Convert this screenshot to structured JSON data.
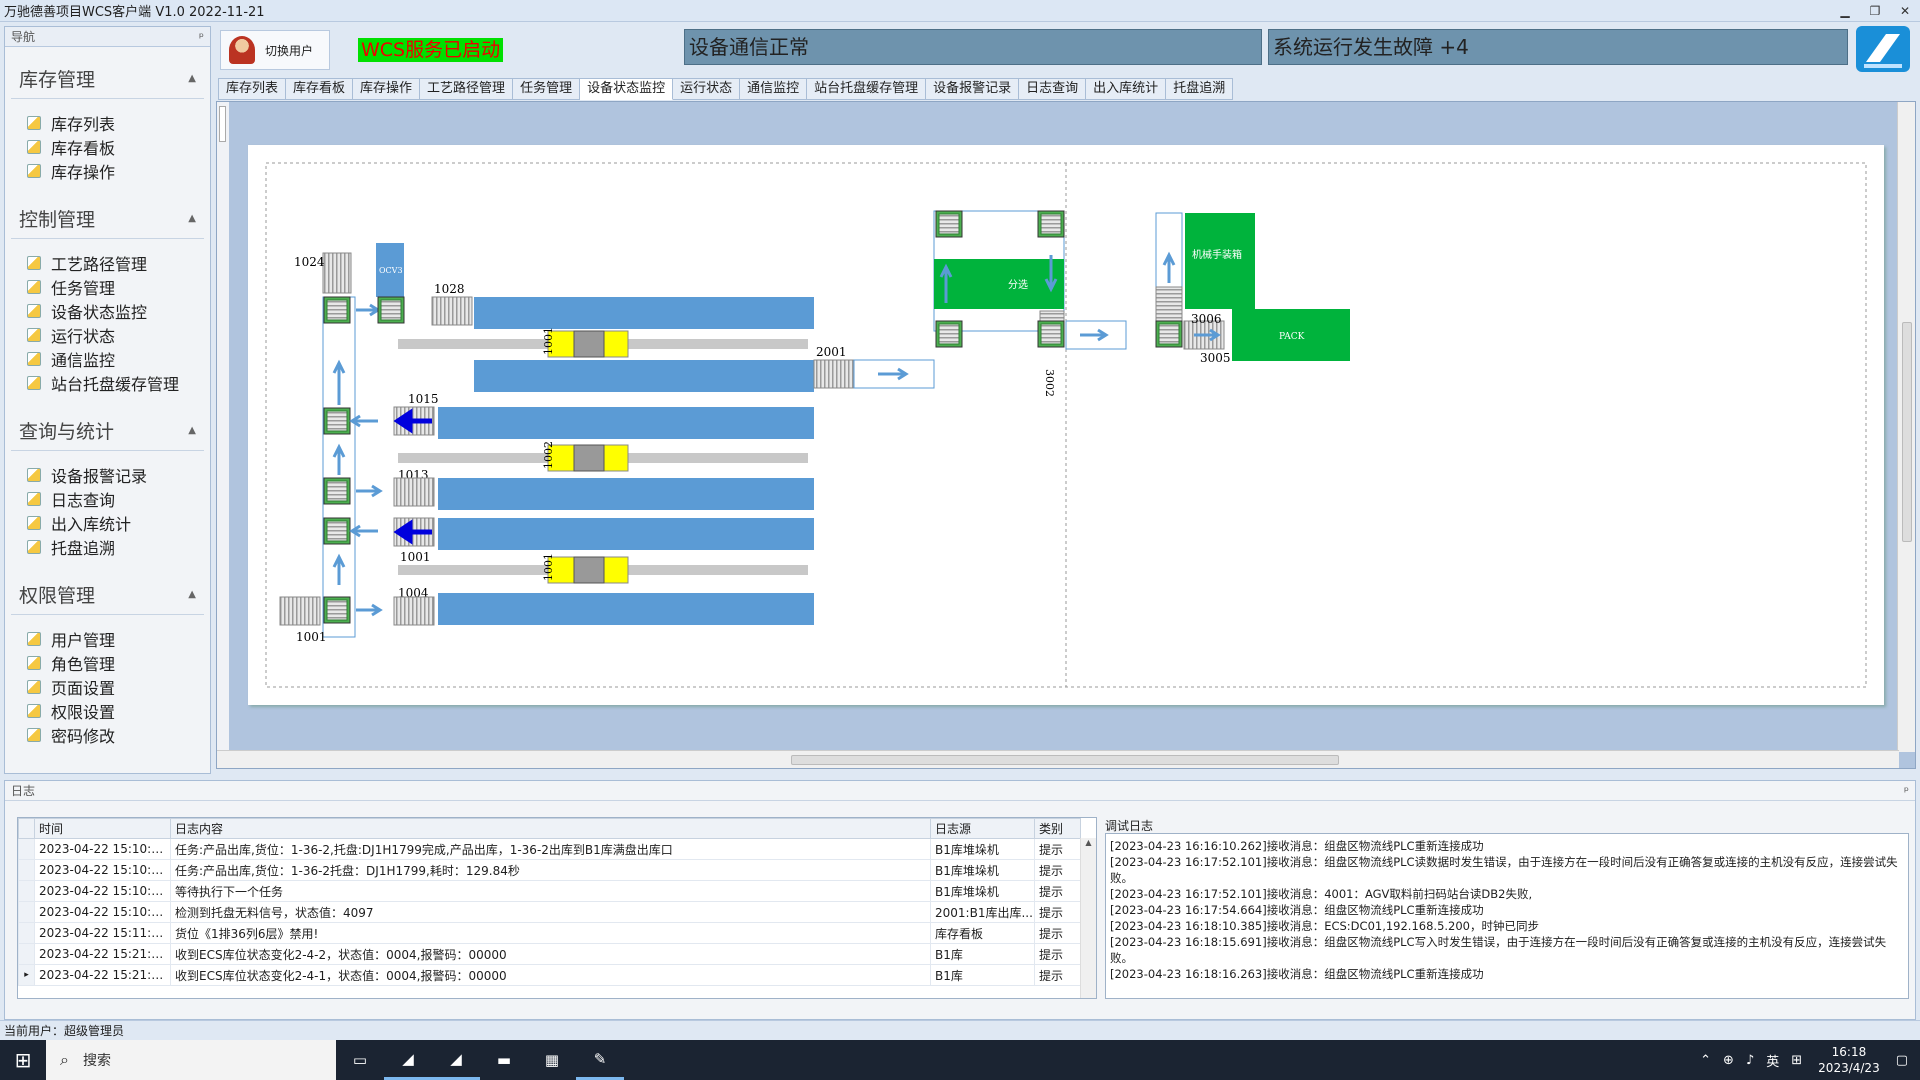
{
  "window": {
    "title": "万驰德善项目WCS客户端 V1.0 2022-11-21",
    "min": "▁",
    "max": "❐",
    "close": "✕"
  },
  "nav": {
    "title": "导航",
    "pin": "ᵖ",
    "groups": [
      {
        "title": "库存管理",
        "items": [
          "库存列表",
          "库存看板",
          "库存操作"
        ]
      },
      {
        "title": "控制管理",
        "items": [
          "工艺路径管理",
          "任务管理",
          "设备状态监控",
          "运行状态",
          "通信监控",
          "站台托盘缓存管理"
        ]
      },
      {
        "title": "查询与统计",
        "items": [
          "设备报警记录",
          "日志查询",
          "出入库统计",
          "托盘追溯"
        ]
      },
      {
        "title": "权限管理",
        "items": [
          "用户管理",
          "角色管理",
          "页面设置",
          "权限设置",
          "密码修改"
        ]
      }
    ]
  },
  "top": {
    "switch_user": "切换用户",
    "service_status": "WCS服务已启动",
    "device_status": "设备通信正常",
    "fault_status": "系统运行发生故障 +4"
  },
  "tabs": [
    "库存列表",
    "库存看板",
    "库存操作",
    "工艺路径管理",
    "任务管理",
    "设备状态监控",
    "运行状态",
    "通信监控",
    "站台托盘缓存管理",
    "设备报警记录",
    "日志查询",
    "出入库统计",
    "托盘追溯"
  ],
  "active_tab": "设备状态监控",
  "diagram": {
    "labels": {
      "n1024": "1024",
      "ocv3": "OCV3",
      "n1028": "1028",
      "n2001": "2001",
      "n1015": "1015",
      "n1013": "1013",
      "n1001a": "1001",
      "n1004": "1004",
      "n1001b": "1001",
      "sort": "分选",
      "n3002": "3002",
      "robot": "机械手装箱",
      "n3006": "3006",
      "pack": "PACK",
      "n3005": "3005",
      "s1": "1001",
      "s2": "1002",
      "s3": "1001"
    }
  },
  "log": {
    "title": "日志",
    "pin": "ᵖ",
    "columns": [
      "时间",
      "日志内容",
      "日志源",
      "类别"
    ],
    "rows": [
      [
        "2023-04-22 15:10:3...",
        "任务:产品出库,货位：1-36-2,托盘:DJ1H1799完成,产品出库，1-36-2出库到B1库满盘出库口",
        "B1库堆垛机",
        "提示"
      ],
      [
        "2023-04-22 15:10:3...",
        "任务:产品出库,货位：1-36-2托盘：DJ1H1799,耗时：129.84秒",
        "B1库堆垛机",
        "提示"
      ],
      [
        "2023-04-22 15:10:3...",
        "等待执行下一个任务",
        "B1库堆垛机",
        "提示"
      ],
      [
        "2023-04-22 15:10:4...",
        "检测到托盘无料信号，状态值：4097",
        "2001:B1库出库...",
        "提示"
      ],
      [
        "2023-04-22 15:11:5...",
        "货位《1排36列6层》禁用!",
        "库存看板",
        "提示"
      ],
      [
        "2023-04-22 15:21:3...",
        "收到ECS库位状态变化2-4-2，状态值：0004,报警码：00000",
        "B1库",
        "提示"
      ],
      [
        "2023-04-22 15:21:3...",
        "收到ECS库位状态变化2-4-1，状态值：0004,报警码：00000",
        "B1库",
        "提示"
      ]
    ],
    "debug_title": "调试日志",
    "debug_lines": [
      "[2023-04-23 16:16:10.262]接收消息：组盘区物流线PLC重新连接成功",
      "[2023-04-23 16:17:52.101]接收消息：组盘区物流线PLC读数据时发生错误，由于连接方在一段时间后没有正确答复或连接的主机没有反应，连接尝试失败。",
      "[2023-04-23 16:17:52.101]接收消息：4001：AGV取料前扫码站台读DB2失败,",
      "[2023-04-23 16:17:54.664]接收消息：组盘区物流线PLC重新连接成功",
      "[2023-04-23 16:18:10.385]接收消息：ECS:DC01,192.168.5.200，时钟已同步",
      "[2023-04-23 16:18:15.691]接收消息：组盘区物流线PLC写入时发生错误，由于连接方在一段时间后没有正确答复或连接的主机没有反应，连接尝试失败。",
      "[2023-04-23 16:18:16.263]接收消息：组盘区物流线PLC重新连接成功"
    ]
  },
  "status": {
    "current_user": "当前用户：超级管理员"
  },
  "taskbar": {
    "search": "搜索",
    "ime": "英",
    "time": "16:18",
    "date": "2023/4/23"
  },
  "colors": {
    "conveyor": "#5b9bd5",
    "station_green": "#00b33c",
    "arrow": "#5b9bd5",
    "status_panel": "#6e93ad"
  }
}
